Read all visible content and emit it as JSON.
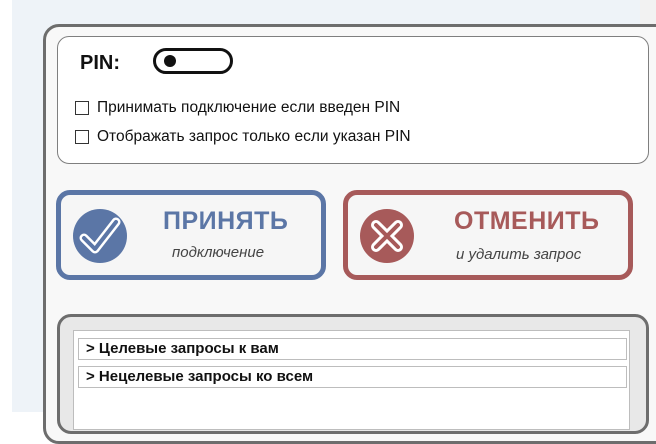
{
  "pin": {
    "label": "PIN:",
    "toggle_on": false
  },
  "options": [
    {
      "label": "Принимать подключение если введен PIN",
      "checked": false
    },
    {
      "label": "Отображать запрос только если указан PIN",
      "checked": false
    }
  ],
  "accept": {
    "title": "ПРИНЯТЬ",
    "subtitle": "подключение",
    "icon": "checkmark-icon",
    "color": "#5b76a6"
  },
  "cancel": {
    "title": "ОТМЕНИТЬ",
    "subtitle": "и удалить запрос",
    "icon": "cross-icon",
    "color": "#a75a5a"
  },
  "requests": [
    {
      "label": "> Целевые запросы к вам"
    },
    {
      "label": "> Нецелевые запросы ко всем"
    }
  ]
}
